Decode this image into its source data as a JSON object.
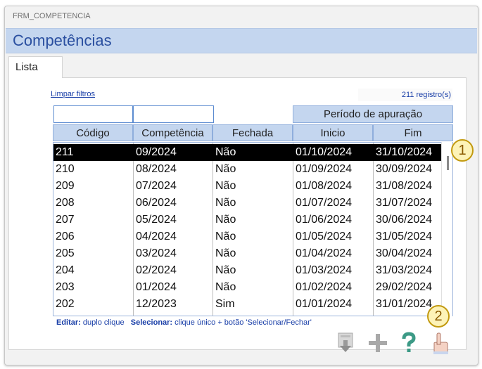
{
  "window": {
    "title": "FRM_COMPETENCIA"
  },
  "header": {
    "title": "Competências"
  },
  "tabs": [
    {
      "label": "Lista"
    }
  ],
  "toolbar": {
    "clear_filters_label": "Limpar filtros",
    "record_count": "211 registro(s)"
  },
  "filters": {
    "codigo_value": "",
    "competencia_value": ""
  },
  "group_header": {
    "label": "Período de apuração"
  },
  "columns": [
    "Código",
    "Competência",
    "Fechada",
    "Inicio",
    "Fim"
  ],
  "rows": [
    {
      "codigo": "211",
      "competencia": "09/2024",
      "fechada": "Não",
      "inicio": "01/10/2024",
      "fim": "31/10/2024",
      "selected": true
    },
    {
      "codigo": "210",
      "competencia": "08/2024",
      "fechada": "Não",
      "inicio": "01/09/2024",
      "fim": "30/09/2024"
    },
    {
      "codigo": "209",
      "competencia": "07/2024",
      "fechada": "Não",
      "inicio": "01/08/2024",
      "fim": "31/08/2024"
    },
    {
      "codigo": "208",
      "competencia": "06/2024",
      "fechada": "Não",
      "inicio": "01/07/2024",
      "fim": "31/07/2024"
    },
    {
      "codigo": "207",
      "competencia": "05/2024",
      "fechada": "Não",
      "inicio": "01/06/2024",
      "fim": "30/06/2024"
    },
    {
      "codigo": "206",
      "competencia": "04/2024",
      "fechada": "Não",
      "inicio": "01/05/2024",
      "fim": "31/05/2024"
    },
    {
      "codigo": "205",
      "competencia": "03/2024",
      "fechada": "Não",
      "inicio": "01/04/2024",
      "fim": "30/04/2024"
    },
    {
      "codigo": "204",
      "competencia": "02/2024",
      "fechada": "Não",
      "inicio": "01/03/2024",
      "fim": "31/03/2024"
    },
    {
      "codigo": "203",
      "competencia": "01/2024",
      "fechada": "Não",
      "inicio": "01/02/2024",
      "fim": "29/02/2024"
    },
    {
      "codigo": "202",
      "competencia": "12/2023",
      "fechada": "Sim",
      "inicio": "01/01/2024",
      "fim": "31/01/2024"
    }
  ],
  "hint": {
    "edit_label": "Editar:",
    "edit_text": "duplo clique",
    "select_label": "Selecionar:",
    "select_text": "clique único + botão 'Selecionar/Fechar'"
  },
  "badges": {
    "one": "1",
    "two": "2"
  },
  "icons": {
    "export": "download-box-icon",
    "add": "plus-icon",
    "help": "question-mark-icon",
    "select": "hand-pointer-icon"
  },
  "colors": {
    "header_band": "#c4d6ef",
    "title_text": "#2a4fa0",
    "link_text": "#1a3fa8",
    "selected_row": "#000000",
    "badge_fill": "#fdf3b8",
    "badge_border": "#c29a10"
  }
}
